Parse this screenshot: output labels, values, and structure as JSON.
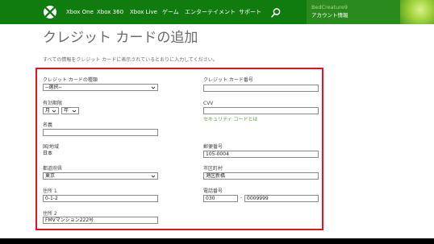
{
  "header": {
    "nav": [
      "Xbox One",
      "Xbox 360",
      "Xbox Live",
      "ゲーム",
      "エンターテイメント",
      "サポート"
    ],
    "profile_name": "BedCreature9",
    "profile_account": "アカウント情報",
    "accent_color": "#107c10"
  },
  "page": {
    "title": "クレジット カードの追加",
    "description": "すべての情報をクレジット カードに表示されているとおりに入力してください。"
  },
  "form": {
    "card_type_label": "クレジット カードの種類",
    "card_type_value": "--選択--",
    "card_number_label": "クレジット カード番号",
    "card_number_value": "",
    "expiry_label": "有効期限",
    "expiry_month": "月",
    "expiry_year": "年",
    "cvv_label": "CVV",
    "cvv_value": "",
    "security_code_link": "セキュリティ コードとは",
    "name_label": "名義",
    "name_value": "",
    "country_label": "国/地域",
    "country_value": "日本",
    "postal_label": "郵便番号",
    "postal_value": "105-0004",
    "prefecture_label": "都道府県",
    "prefecture_value": "東京",
    "city_label": "市区町村",
    "city_value": "港区新橋",
    "address1_label": "住所 1",
    "address1_value": "0-1-2",
    "phone_label": "電話番号",
    "phone_area": "030",
    "phone_number": "0009999",
    "phone_separator": "-",
    "address2_label": "住所 2",
    "address2_value": "FMVマンション222号"
  }
}
